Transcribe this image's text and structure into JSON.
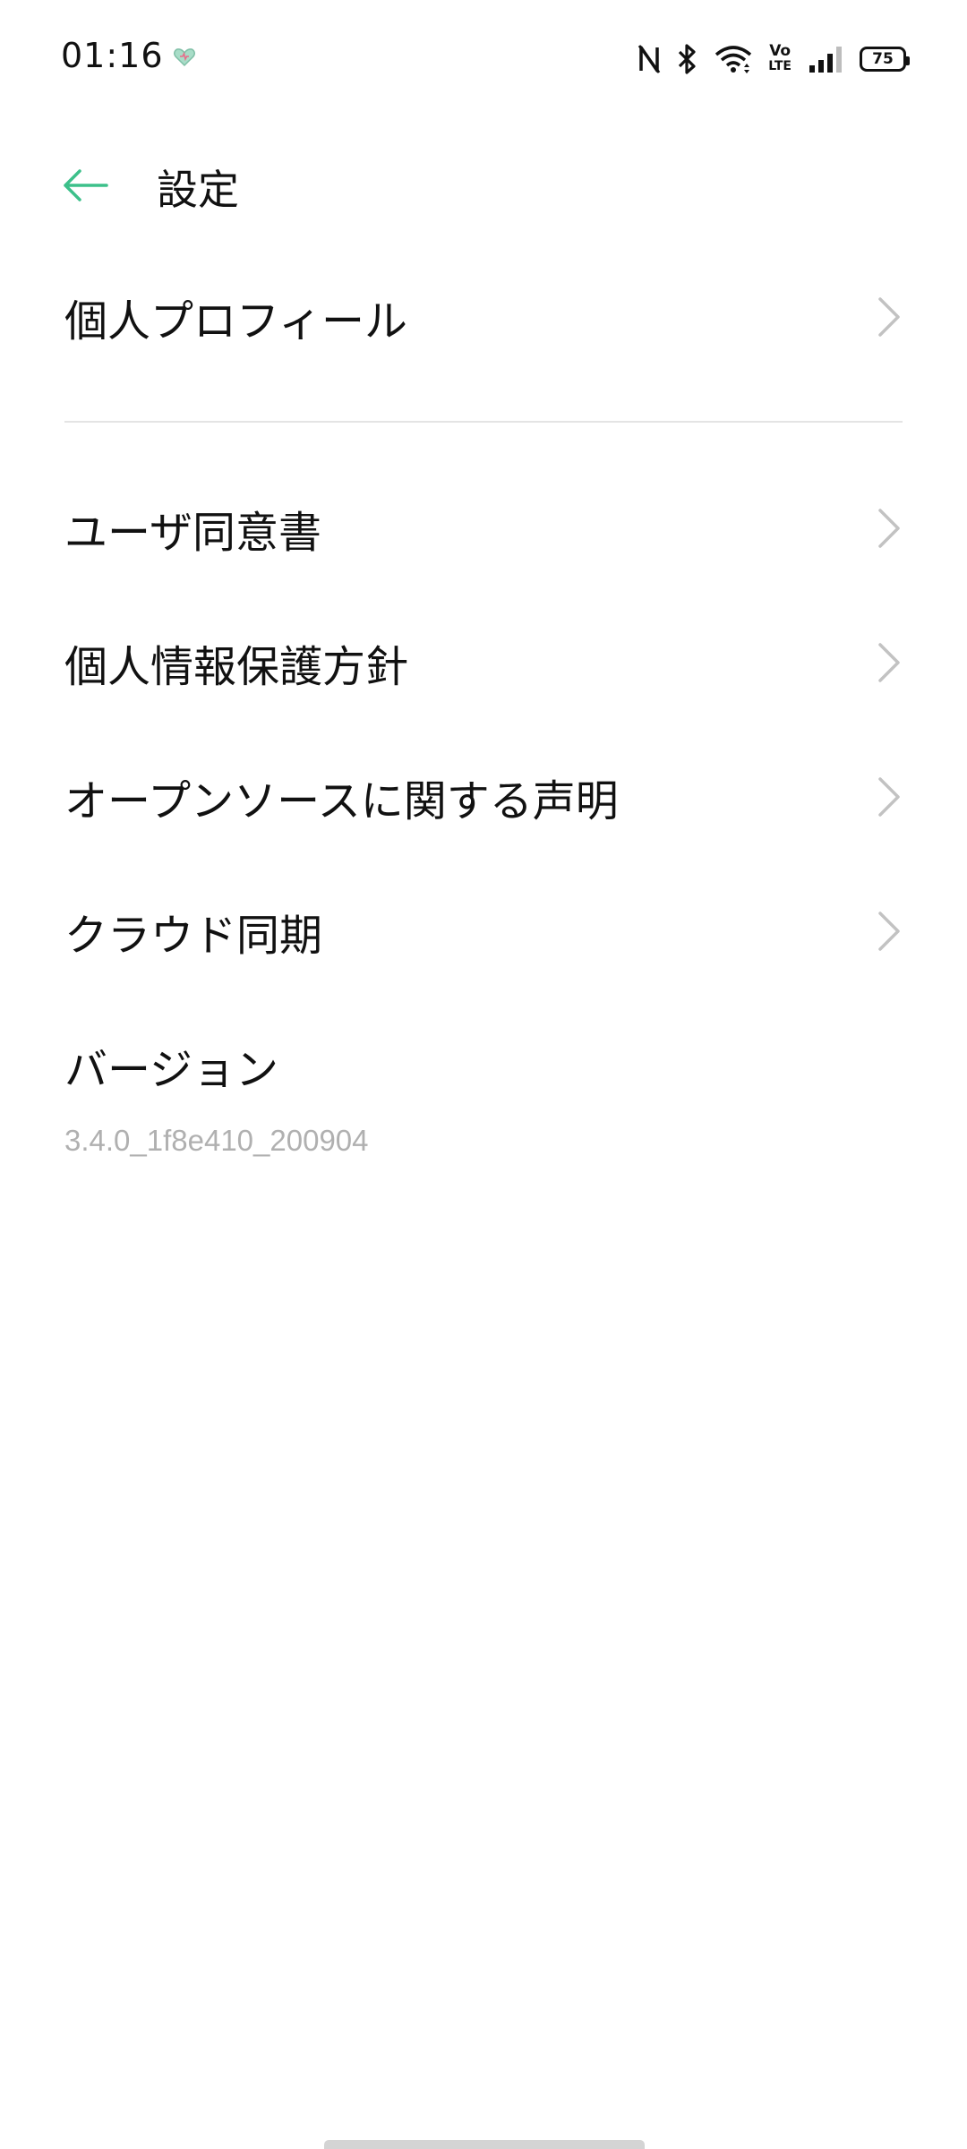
{
  "status_bar": {
    "time": "01:16",
    "icons": [
      "heart-notification-icon",
      "nfc-icon",
      "bluetooth-icon",
      "wifi-icon",
      "volte-icon",
      "signal-icon",
      "battery-icon"
    ],
    "volte_top": "Vo",
    "volte_bottom": "LTE",
    "battery_level": "75"
  },
  "header": {
    "title": "設定",
    "back_icon": "back-arrow-icon",
    "accent_color": "#3cc08a"
  },
  "menu": {
    "profile": {
      "label": "個人プロフィール"
    },
    "items": [
      {
        "label": "ユーザ同意書"
      },
      {
        "label": "個人情報保護方針"
      },
      {
        "label": "オープンソースに関する声明"
      },
      {
        "label": "クラウド同期"
      }
    ],
    "chevron_icon": "chevron-right-icon"
  },
  "version": {
    "label": "バージョン",
    "value": "3.4.0_1f8e410_200904"
  }
}
